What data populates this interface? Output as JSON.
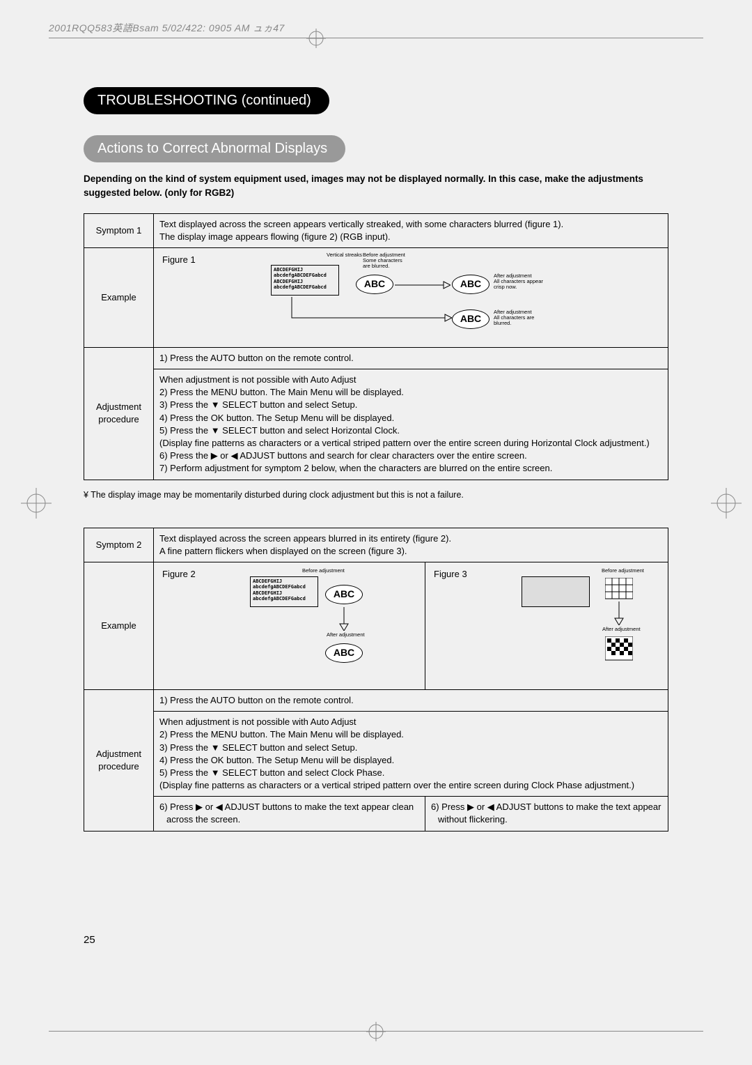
{
  "header_line": "2001RQQ583英語Bsam  5/02/422:  0905 AM   ュヵ47",
  "title_pill": "TROUBLESHOOTING (continued)",
  "section_pill": "Actions to Correct Abnormal Displays",
  "intro": "Depending on the kind of system equipment used, images may not be displayed normally.  In this case, make the adjustments suggested below. (only for RGB2)",
  "table1": {
    "row1_label": "Symptom 1",
    "row1_text": "Text displayed across the screen appears vertically streaked, with some characters blurred (figure 1).\nThe display image appears flowing (figure 2) (RGB input).",
    "row2_label": "Example",
    "row3_label": "Adjustment procedure",
    "row3_line1": "1) Press the AUTO button on the remote control.",
    "row3_block": "When adjustment is not possible with Auto Adjust\n2) Press the MENU button. The Main Menu will be displayed.\n3) Press the ▼ SELECT button and select Setup.\n4) Press the OK button. The Setup Menu will be displayed.\n5) Press the ▼ SELECT button and select Horizontal Clock.\n(Display fine patterns as characters or a vertical striped pattern over the entire screen during Horizontal Clock adjustment.)\n6) Press the ▶ or ◀ ADJUST buttons and search for clear characters over the entire screen.\n7) Perform adjustment for symptom 2 below, when the characters are blurred on the entire screen."
  },
  "fig1": {
    "label": "Figure 1",
    "vertical_streaks": "Vertical streaks",
    "before_adj": "Before adjustment\nSome characters\nare blurred.",
    "screen_lines": "ABCDEFGHIJ\nabcdefgABCDEFGabcd\nABCDEFGHIJ\nabcdefgABCDEFGabcd",
    "oval_text": "ABC",
    "after_adj1": "After adjustment\nAll characters appear\ncrisp now.",
    "after_adj2": "After adjustment\nAll characters are\nblurred."
  },
  "note": "¥ The display image may be momentarily disturbed during clock adjustment but this is not a failure.",
  "table2": {
    "row1_label": "Symptom 2",
    "row1_text": "Text displayed across the screen appears blurred in its entirety (figure 2).\nA fine pattern flickers when displayed on the screen (figure 3).",
    "row2_label": "Example",
    "row3_label": "Adjustment procedure",
    "row3_line1": "1) Press the AUTO button on the remote control.",
    "row3_block": "When adjustment is not possible with Auto Adjust\n2) Press the MENU button. The Main Menu will be displayed.\n3) Press the ▼  SELECT button and select Setup.\n4) Press the OK button. The Setup Menu will be displayed.\n5) Press the ▼ SELECT button and select Clock Phase.\n(Display fine patterns as characters or a vertical striped pattern over the entire screen during Clock Phase adjustment.)",
    "row3_left6": "6) Press ▶ or ◀ ADJUST buttons to make the text appear clean across the screen.",
    "row3_right6": "6) Press ▶ or ◀ ADJUST buttons to make the text appear without flickering."
  },
  "fig2": {
    "label": "Figure 2",
    "before": "Before adjustment",
    "after": "After adjustment",
    "screen_lines": "ABCDEFGHIJ\nabcdefgABCDEFGabcd\nABCDEFGHIJ\nabcdefgABCDEFGabcd",
    "oval_text": "ABC"
  },
  "fig3": {
    "label": "Figure 3",
    "before": "Before adjustment",
    "after": "After adjustment"
  },
  "page_number": "25"
}
